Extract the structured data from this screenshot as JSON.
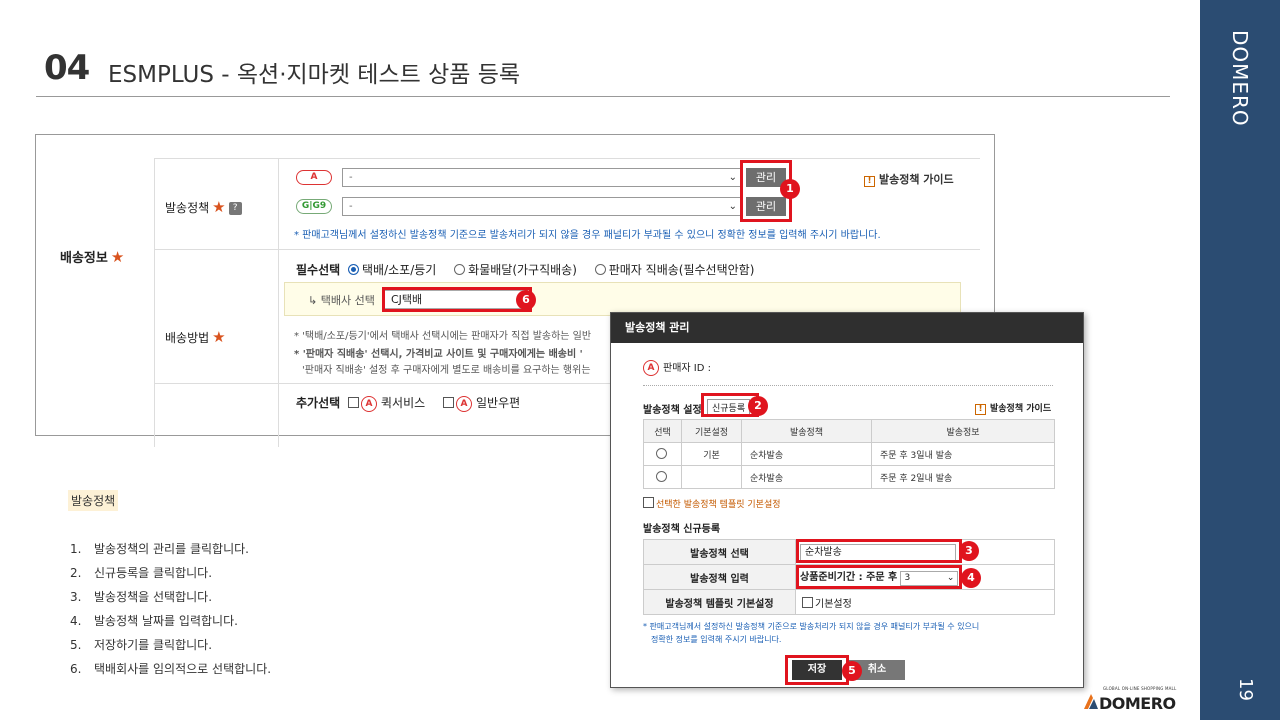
{
  "header": {
    "number": "04",
    "title": "ESMPLUS - 옥션·지마켓 테스트 상품 등록"
  },
  "sidebar": {
    "brand": "DOMERO",
    "page_number": "19"
  },
  "form": {
    "shipping_info_label": "배송정보",
    "policy_label": "발송정책",
    "auction_badge": "A",
    "gmarket_badge": "G|G9",
    "auction_select_value": "-",
    "gmarket_select_value": "-",
    "manage_button": "관리",
    "guide_label": "발송정책 가이드",
    "policy_note": "* 판매고객님께서 설정하신 발송정책 기준으로 발송처리가 되지 않을 경우 패널티가 부과될 수 있으니 정확한 정보를 입력해 주시기 바랍니다.",
    "method_label": "배송방법",
    "required_label": "필수선택",
    "option_parcel": "택배/소포/등기",
    "option_freight": "화물배달(가구직배송)",
    "option_direct": "판매자 직배송(필수선택안함)",
    "courier_label": "↳ 택배사 선택",
    "courier_value": "CJ택배",
    "method_note1": "* '택배/소포/등기'에서 택배사 선택시에는 판매자가 직접 발송하는 일반",
    "method_note2": "* '판매자 직배송' 선택시, 가격비교 사이트 및 구매자에게는 배송비 '",
    "method_note3": "'판매자 직배송' 설정 후 구매자에게 별도로 배송비를 요구하는 행위는",
    "optional_label": "추가선택",
    "option_quick": "퀵서비스",
    "option_mail": "일반우편"
  },
  "modal": {
    "title": "발송정책 관리",
    "seller_id_label": "판매자 ID :",
    "settings_label": "발송정책 설정",
    "new_register_button": "신규등록",
    "guide_label": "발송정책 가이드",
    "table_headers": [
      "선택",
      "기본설정",
      "발송정책",
      "발송정보"
    ],
    "table_rows": [
      {
        "default": "기본",
        "policy": "순차발송",
        "info": "주문 후 3일내 발송"
      },
      {
        "default": "",
        "policy": "순차발송",
        "info": "주문 후 2일내 발송"
      }
    ],
    "set_default_label": "선택한 발송정책 템플릿 기본설정",
    "new_section_title": "발송정책 신규등록",
    "row_select_label": "발송정책 선택",
    "row_select_value": "순차발송",
    "row_input_label": "발송정책 입력",
    "row_input_prefix": "상품준비기간 : 주문 후",
    "row_input_value": "3",
    "row_template_label": "발송정책 템플릿 기본설정",
    "row_template_check": "기본설정",
    "note_line1": "* 판매고객님께서 설정하신 발송정책 기준으로 발송처리가 되지 않을 경우 패널티가 부과될 수 있으니",
    "note_line2": "정확한 정보를 입력해 주시기 바랍니다.",
    "save_button": "저장",
    "cancel_button": "취소"
  },
  "callouts": [
    "1",
    "2",
    "3",
    "4",
    "5",
    "6"
  ],
  "instructions": {
    "section_label": "발송정책",
    "steps": [
      {
        "n": "1.",
        "text": "발송정책의 관리를 클릭합니다."
      },
      {
        "n": "2.",
        "text": "신규등록을 클릭합니다."
      },
      {
        "n": "3.",
        "text": "발송정책을 선택합니다."
      },
      {
        "n": "4.",
        "text": "발송정책 날짜를 입력합니다."
      },
      {
        "n": "5.",
        "text": "저장하기를 클릭합니다."
      },
      {
        "n": "6.",
        "text": "택배회사를 임의적으로 선택합니다."
      }
    ]
  },
  "logo": {
    "tagline": "GLOBAL ON-LINE SHOPPING MALL",
    "name": "DOMERO"
  },
  "colors": {
    "sidebar": "#2b4c72",
    "highlight": "#e0141e",
    "note_blue": "#1a5fb4"
  }
}
